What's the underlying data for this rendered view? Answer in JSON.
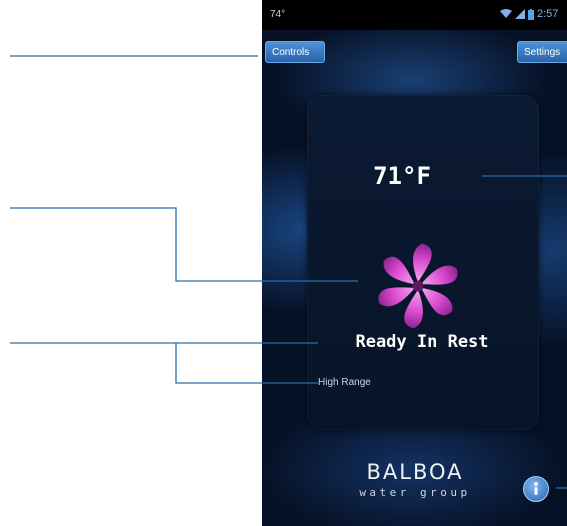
{
  "status_bar": {
    "temperature": "74°",
    "time": "2:57"
  },
  "toolbar": {
    "controls_label": "Controls",
    "settings_label": "Settings"
  },
  "main": {
    "temperature": "71°F",
    "status": "Ready In Rest",
    "range": "High Range"
  },
  "brand": {
    "name": "BALBOA",
    "subtitle": "water group"
  },
  "icons": {
    "logo": "balboa-swirl-icon",
    "info": "info-icon",
    "wifi": "wifi-icon",
    "signal": "signal-icon",
    "battery": "battery-icon"
  },
  "colors": {
    "accent": "#3f83cf",
    "swirl": "#d94ad0",
    "callout_line": "#2a6ea8",
    "background": "#061126"
  }
}
